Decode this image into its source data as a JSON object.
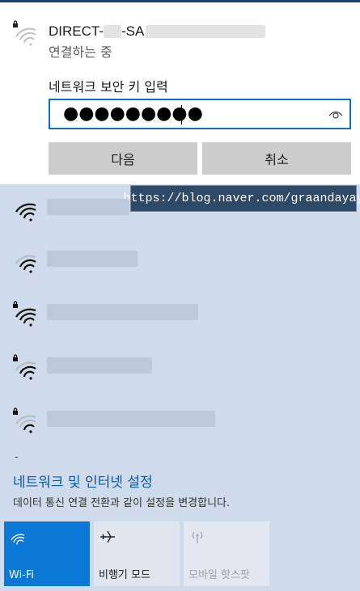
{
  "connecting_network": {
    "ssid_prefix": "DIRECT-",
    "ssid_suffix": "-SA",
    "status": "연결하는 중",
    "key_label": "네트워크 보안 키 입력",
    "password_mask": "●●●●●●●●●",
    "next_button": "다음",
    "cancel_button": "취소",
    "icon": "wifi-locked-icon"
  },
  "watermark": "https://blog.naver.com/graandayay",
  "networks": [
    {
      "icon": "wifi-icon",
      "secured": false
    },
    {
      "icon": "wifi-icon",
      "secured": false
    },
    {
      "icon": "wifi-locked-icon",
      "secured": true
    },
    {
      "icon": "wifi-locked-icon",
      "secured": true
    },
    {
      "icon": "wifi-locked-icon",
      "secured": true
    }
  ],
  "dash": "-",
  "settings": {
    "link": "네트워크 및 인터넷 설정",
    "description": "데이터 통신 연결 전환과 같이 설정을 변경합니다."
  },
  "quick_actions": [
    {
      "label": "Wi-Fi",
      "icon": "wifi-icon",
      "active": true
    },
    {
      "label": "비행기 모드",
      "icon": "airplane-icon",
      "active": false
    },
    {
      "label": "모바일 핫스팟",
      "icon": "hotspot-icon",
      "active": false,
      "disabled": true
    }
  ],
  "colors": {
    "accent": "#0a78d4",
    "link": "#0a5aa8",
    "panel_bg": "#cfdaea"
  }
}
